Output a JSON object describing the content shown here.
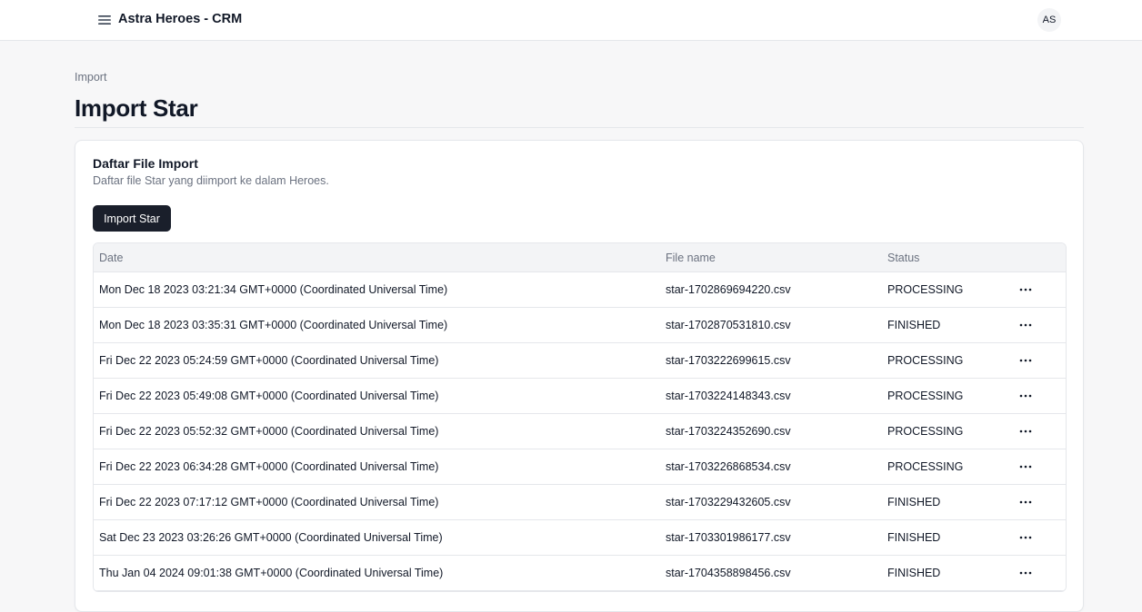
{
  "header": {
    "app_title": "Astra Heroes - CRM",
    "avatar_initials": "AS"
  },
  "breadcrumb": "Import",
  "page_title": "Import Star",
  "card": {
    "title": "Daftar File Import",
    "description": "Daftar file Star yang diimport ke dalam Heroes.",
    "import_button_label": "Import Star"
  },
  "table": {
    "columns": [
      "Date",
      "File name",
      "Status"
    ],
    "rows": [
      {
        "date": "Mon Dec 18 2023 03:21:34 GMT+0000 (Coordinated Universal Time)",
        "file": "star-1702869694220.csv",
        "status": "PROCESSING"
      },
      {
        "date": "Mon Dec 18 2023 03:35:31 GMT+0000 (Coordinated Universal Time)",
        "file": "star-1702870531810.csv",
        "status": "FINISHED"
      },
      {
        "date": "Fri Dec 22 2023 05:24:59 GMT+0000 (Coordinated Universal Time)",
        "file": "star-1703222699615.csv",
        "status": "PROCESSING"
      },
      {
        "date": "Fri Dec 22 2023 05:49:08 GMT+0000 (Coordinated Universal Time)",
        "file": "star-1703224148343.csv",
        "status": "PROCESSING"
      },
      {
        "date": "Fri Dec 22 2023 05:52:32 GMT+0000 (Coordinated Universal Time)",
        "file": "star-1703224352690.csv",
        "status": "PROCESSING"
      },
      {
        "date": "Fri Dec 22 2023 06:34:28 GMT+0000 (Coordinated Universal Time)",
        "file": "star-1703226868534.csv",
        "status": "PROCESSING"
      },
      {
        "date": "Fri Dec 22 2023 07:17:12 GMT+0000 (Coordinated Universal Time)",
        "file": "star-1703229432605.csv",
        "status": "FINISHED"
      },
      {
        "date": "Sat Dec 23 2023 03:26:26 GMT+0000 (Coordinated Universal Time)",
        "file": "star-1703301986177.csv",
        "status": "FINISHED"
      },
      {
        "date": "Thu Jan 04 2024 09:01:38 GMT+0000 (Coordinated Universal Time)",
        "file": "star-1704358898456.csv",
        "status": "FINISHED"
      }
    ]
  },
  "icons": {
    "menu": "hamburger-menu-icon",
    "row_actions": "more-horizontal-icon"
  },
  "colors": {
    "primary_button": "#1a1f2b",
    "muted_text": "#6b7280",
    "border": "#e5e7eb",
    "table_header_bg": "#f3f4f6"
  }
}
